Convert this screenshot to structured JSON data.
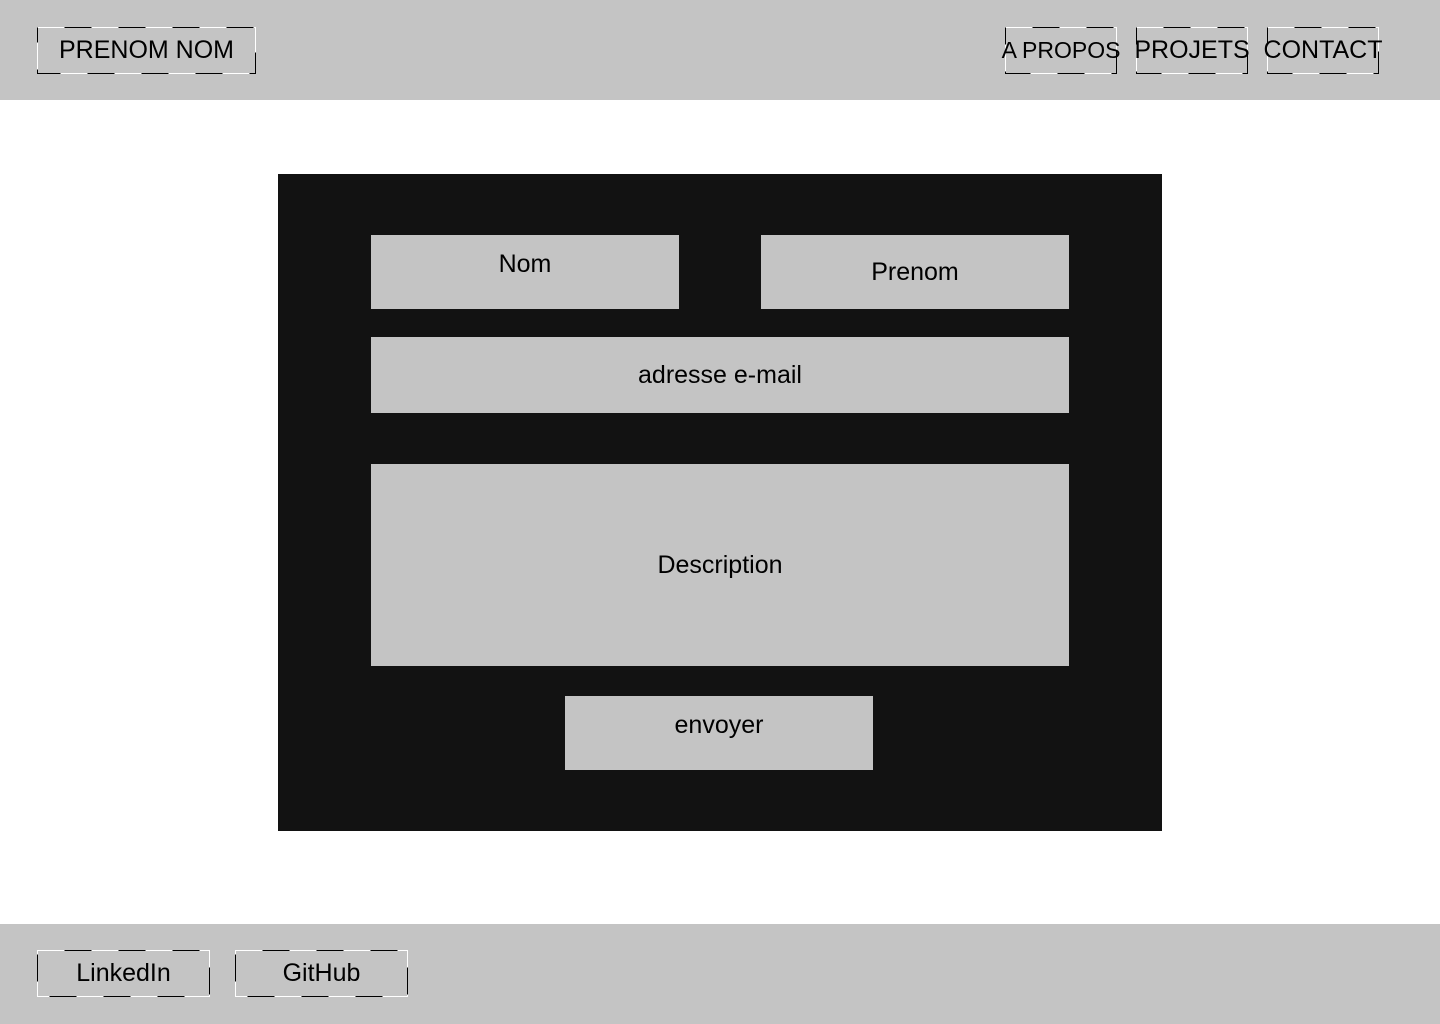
{
  "header": {
    "brand": "PRENOM NOM",
    "nav": {
      "apropos": "A PROPOS",
      "projets": "PROJETS",
      "contact": "CONTACT"
    }
  },
  "contact_form": {
    "nom_label": "Nom",
    "prenom_label": "Prenom",
    "email_label": "adresse e-mail",
    "description_label": "Description",
    "submit_label": "envoyer"
  },
  "footer": {
    "linkedin": "LinkedIn",
    "github": "GitHub"
  },
  "colors": {
    "bar_gray": "#c4c4c4",
    "panel_dark": "#121212",
    "background": "#ffffff"
  }
}
